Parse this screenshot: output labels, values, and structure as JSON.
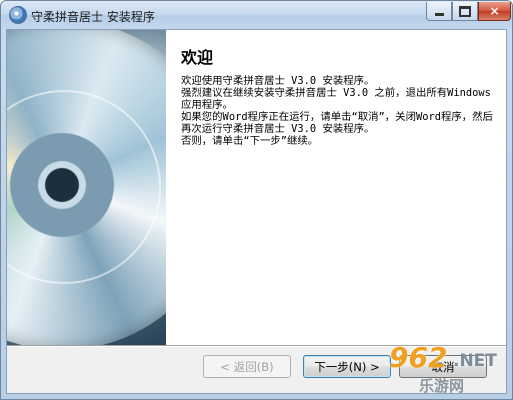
{
  "window": {
    "title": "守柔拼音居士 安装程序",
    "background_tabs": [
      "",
      "",
      ""
    ]
  },
  "title_buttons": {
    "minimize_icon": "minimize-icon",
    "maximize_icon": "maximize-icon",
    "close_label": "×"
  },
  "welcome": {
    "heading": "欢迎",
    "paragraphs": [
      "欢迎使用守柔拼音居士 V3.0 安装程序。",
      "强烈建议在继续安装守柔拼音居士 V3.0 之前，退出所有Windows应用程序。",
      "如果您的Word程序正在运行，请单击“取消”，关闭Word程序，然后再次运行守柔拼音居士 V3.0 安装程序。",
      "否则，请单击“下一步”继续。"
    ]
  },
  "buttons": {
    "back": "< 返回(B)",
    "next": "下一步(N) >",
    "cancel": "取消"
  },
  "watermark": {
    "number": "962",
    "suffix": ".NET",
    "site": "乐游网"
  },
  "colors": {
    "title_bar": "#c4d8ee",
    "close_button": "#c23b22",
    "dialog_bg": "#f0f0f0",
    "watermark_accent": "#f0a020"
  }
}
